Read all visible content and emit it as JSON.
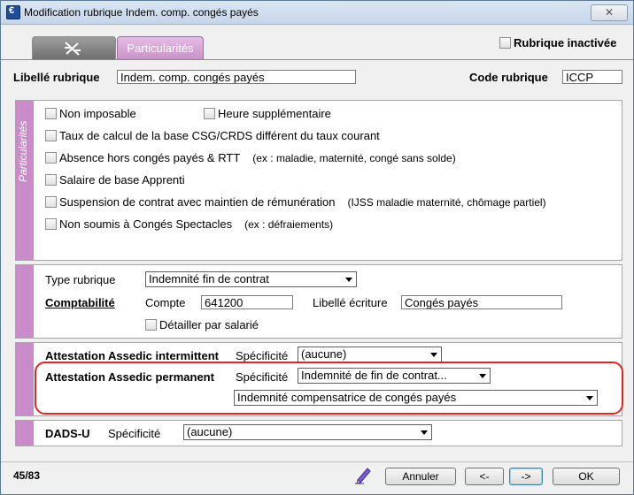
{
  "window": {
    "title": "Modification rubrique Indem. comp. congés payés",
    "close_label": "✕"
  },
  "tabs": [
    {
      "label": ""
    },
    {
      "label": "Particularités"
    }
  ],
  "rubrique_inactivee": "Rubrique inactivée",
  "libelle": {
    "label": "Libellé rubrique",
    "value": "Indem. comp. congés payés"
  },
  "code": {
    "label": "Code rubrique",
    "value": "ICCP"
  },
  "particularites": {
    "strip_label": "Particularités",
    "options": [
      {
        "label": "Non imposable",
        "note": ""
      },
      {
        "label": "Heure supplémentaire",
        "note": ""
      },
      {
        "label": "Taux de calcul de la base CSG/CRDS différent du taux courant",
        "note": ""
      },
      {
        "label": "Absence hors congés payés & RTT",
        "note": "(ex : maladie, maternité, congé sans solde)"
      },
      {
        "label": "Salaire de base Apprenti",
        "note": ""
      },
      {
        "label": "Suspension de contrat avec maintien de rémunération",
        "note": "(IJSS maladie maternité, chômage partiel)"
      },
      {
        "label": "Non soumis à Congés Spectacles",
        "note": "(ex : défraiements)"
      }
    ]
  },
  "type_rubrique": {
    "label": "Type rubrique",
    "value": "Indemnité fin de contrat"
  },
  "comptabilite": {
    "label": "Comptabilité",
    "compte_label": "Compte",
    "compte_value": "641200",
    "libelle_ecriture_label": "Libellé écriture",
    "libelle_ecriture_value": "Congés payés",
    "detailler_label": "Détailler par salarié"
  },
  "assedic_intermittent": {
    "label": "Attestation Assedic intermittent",
    "spec_label": "Spécificité",
    "value": "(aucune)"
  },
  "assedic_permanent": {
    "label": "Attestation Assedic permanent",
    "spec_label": "Spécificité",
    "value": "Indemnité de fin de contrat...",
    "value2": "Indemnité compensatrice de congés payés"
  },
  "dads": {
    "label": "DADS-U",
    "spec_label": "Spécificité",
    "value": "(aucune)"
  },
  "footer": {
    "counter": "45/83",
    "annuler": "Annuler",
    "prev": "<-",
    "next": "->",
    "ok": "OK"
  }
}
